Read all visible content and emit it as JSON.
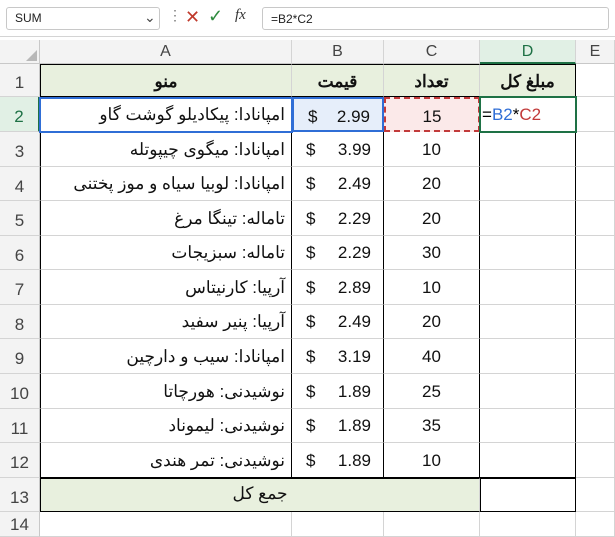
{
  "formula_bar": {
    "name_box": "SUM",
    "formula": "=B2*C2",
    "fx_label": "fx",
    "kebab": "⋮",
    "cancel_glyph": "✕",
    "enter_glyph": "✓",
    "chevron": "⌄"
  },
  "columns": [
    "A",
    "B",
    "C",
    "D",
    "E"
  ],
  "rows": [
    "1",
    "2",
    "3",
    "4",
    "5",
    "6",
    "7",
    "8",
    "9",
    "10",
    "11",
    "12",
    "13",
    "14"
  ],
  "header_row": {
    "menu": "منو",
    "price": "قیمت",
    "qty": "تعداد",
    "amount": "مبلغ کل"
  },
  "currency_symbol": "$",
  "items": [
    {
      "name": "امپانادا: پیکادیلو گوشت گاو",
      "price": "2.99",
      "qty": "15"
    },
    {
      "name": "امپانادا: میگوی چیپوتله",
      "price": "3.99",
      "qty": "10"
    },
    {
      "name": "امپانادا: لوبیا سیاه و موز پختنی",
      "price": "2.49",
      "qty": "20"
    },
    {
      "name": "تاماله: تینگا مرغ",
      "price": "2.29",
      "qty": "20"
    },
    {
      "name": "تاماله: سبزیجات",
      "price": "2.29",
      "qty": "30"
    },
    {
      "name": "آرپیا: کارنیتاس",
      "price": "2.89",
      "qty": "10"
    },
    {
      "name": "آرپیا: پنیر سفید",
      "price": "2.49",
      "qty": "20"
    },
    {
      "name": "امپانادا: سیب و دارچین",
      "price": "3.19",
      "qty": "40"
    },
    {
      "name": "نوشیدنی: هورچاتا",
      "price": "1.89",
      "qty": "25"
    },
    {
      "name": "نوشیدنی: لیموناد",
      "price": "1.89",
      "qty": "35"
    },
    {
      "name": "نوشیدنی: تمر هندی",
      "price": "1.89",
      "qty": "10"
    }
  ],
  "total_row": {
    "label": "جمع کل"
  },
  "edit_cell": {
    "eq": "=",
    "ref1": "B2",
    "op": "*",
    "ref2": "C2"
  },
  "colors": {
    "header_fill": "#e8f0de",
    "ref1": "#2f6ed6",
    "ref2": "#c23a3a",
    "active": "#1e7145"
  }
}
